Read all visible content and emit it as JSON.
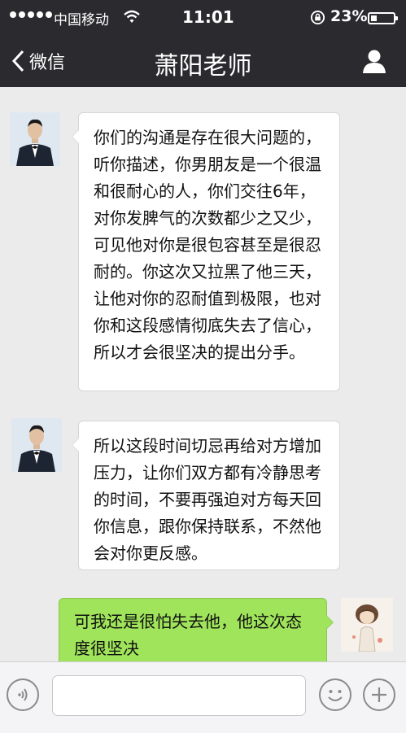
{
  "status_bar": {
    "carrier": "中国移动",
    "time": "11:01",
    "battery": "23%",
    "battery_level": 0.23
  },
  "nav": {
    "back_label": "微信",
    "title": "萧阳老师"
  },
  "messages": [
    {
      "sender": "teacher",
      "text": "你们的沟通是存在很大问题的，听你描述，你男朋友是一个很温和很耐心的人，你们交往6年，对你发脾气的次数都少之又少，可见他对你是很包容甚至是很忍耐的。你这次又拉黑了他三天，让他对你的忍耐值到极限，也对你和这段感情彻底失去了信心，所以才会很坚决的提出分手。"
    },
    {
      "sender": "teacher",
      "text": "所以这段时间切忌再给对方增加压力，让你们双方都有冷静思考的时间，不要再强迫对方每天回你信息，跟你保持联系，不然他会对你更反感。"
    },
    {
      "sender": "self",
      "text": "可我还是很怕失去他，他这次态度很坚决"
    }
  ],
  "input": {
    "value": "",
    "placeholder": ""
  },
  "colors": {
    "header_bg": "#2b2b2f",
    "chat_bg": "#ebebeb",
    "outgoing_bubble": "#9fe45a",
    "incoming_bubble": "#ffffff"
  },
  "icons": [
    "signal-icon",
    "wifi-icon",
    "lock-rotation-icon",
    "battery-icon",
    "back-chevron-icon",
    "profile-icon",
    "voice-icon",
    "emoji-icon",
    "plus-icon"
  ]
}
